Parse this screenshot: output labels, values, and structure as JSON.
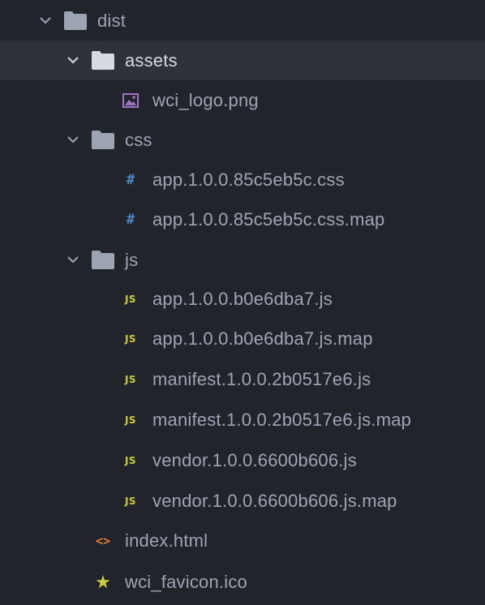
{
  "tree": {
    "items": [
      {
        "label": "dist",
        "type": "folder",
        "expanded": true,
        "icon": "folder-icon"
      },
      {
        "label": "assets",
        "type": "folder",
        "expanded": true,
        "icon": "folder-icon",
        "selected": true
      },
      {
        "label": "wci_logo.png",
        "type": "file",
        "icon": "image-icon"
      },
      {
        "label": "css",
        "type": "folder",
        "expanded": true,
        "icon": "folder-icon"
      },
      {
        "label": "app.1.0.0.85c5eb5c.css",
        "type": "file",
        "icon": "css-hash-icon"
      },
      {
        "label": "app.1.0.0.85c5eb5c.css.map",
        "type": "file",
        "icon": "css-hash-icon"
      },
      {
        "label": "js",
        "type": "folder",
        "expanded": true,
        "icon": "folder-icon"
      },
      {
        "label": "app.1.0.0.b0e6dba7.js",
        "type": "file",
        "icon": "js-icon"
      },
      {
        "label": "app.1.0.0.b0e6dba7.js.map",
        "type": "file",
        "icon": "js-icon"
      },
      {
        "label": "manifest.1.0.0.2b0517e6.js",
        "type": "file",
        "icon": "js-icon"
      },
      {
        "label": "manifest.1.0.0.2b0517e6.js.map",
        "type": "file",
        "icon": "js-icon"
      },
      {
        "label": "vendor.1.0.0.6600b606.js",
        "type": "file",
        "icon": "js-icon"
      },
      {
        "label": "vendor.1.0.0.6600b606.js.map",
        "type": "file",
        "icon": "js-icon"
      },
      {
        "label": "index.html",
        "type": "file",
        "icon": "html-code-icon"
      },
      {
        "label": "wci_favicon.ico",
        "type": "file",
        "icon": "star-icon"
      }
    ],
    "icon_glyphs": {
      "hash": "#",
      "js": "JS",
      "html": "<>",
      "star": "★"
    }
  },
  "colors": {
    "background": "#21252b",
    "selected_row": "#2c313a",
    "text": "#9da5b4",
    "folder": "#9da5b4",
    "css_icon": "#4f86c6",
    "js_icon": "#cbcb41",
    "html_icon": "#e37933",
    "image_icon": "#a074c4",
    "star_icon": "#cbcb41"
  }
}
